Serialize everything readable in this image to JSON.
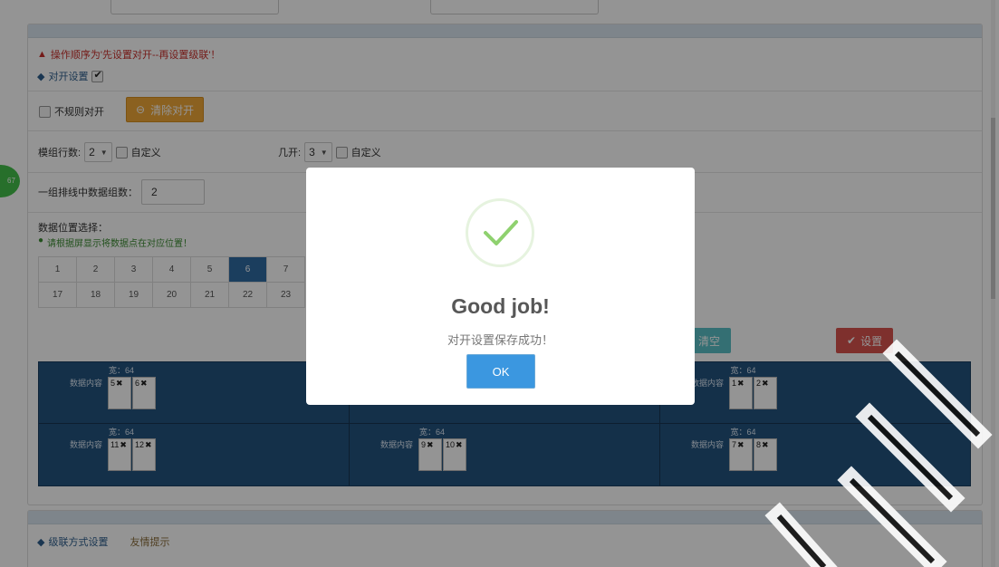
{
  "notices": {
    "warning": "操作顺序为'先设置对开--再设置级联'！",
    "pair_setting_label": "对开设置",
    "data_position_title": "数据位置选择：",
    "data_position_hint": "请根据屏显示将数据点在对应位置！"
  },
  "controls": {
    "irregular_pair_label": "不规则对开",
    "clear_pair_button": "清除对开",
    "module_rows_label": "模组行数:",
    "module_rows_value": "2",
    "custom_label_1": "自定义",
    "split_label": "几开:",
    "split_value": "3",
    "custom_label_2": "自定义",
    "group_count_label": "一组排线中数据组数：",
    "group_count_value": "2",
    "clear_button": "清空",
    "set_button": "设置"
  },
  "position_grid": {
    "row1": [
      "1",
      "2",
      "3",
      "4",
      "5",
      "6",
      "7"
    ],
    "row2": [
      "17",
      "18",
      "19",
      "20",
      "21",
      "22",
      "23"
    ],
    "selected": "6"
  },
  "board": {
    "cells": [
      {
        "width_label": "宽：64",
        "content_label": "数据内容",
        "chips": [
          "5",
          "6"
        ]
      },
      {
        "width_label": "",
        "content_label": "",
        "chips": []
      },
      {
        "width_label": "宽：64",
        "content_label": "数据内容",
        "chips": [
          "1",
          "2"
        ]
      },
      {
        "width_label": "宽：64",
        "content_label": "数据内容",
        "chips": [
          "11",
          "12"
        ]
      },
      {
        "width_label": "宽：64",
        "content_label": "数据内容",
        "chips": [
          "9",
          "10"
        ]
      },
      {
        "width_label": "宽：64",
        "content_label": "数据内容",
        "chips": [
          "7",
          "8"
        ]
      }
    ]
  },
  "footer": {
    "cascade_label": "级联方式设置",
    "tip_link": "友情提示"
  },
  "side_badge": "67",
  "modal": {
    "title": "Good job!",
    "message": "对开设置保存成功！",
    "ok_label": "OK"
  },
  "colors": {
    "accent_blue": "#24537f",
    "success_green": "#8fd16f",
    "ok_button": "#3b97e0",
    "warning_red": "#c9302c",
    "orange_button": "#f0a838"
  }
}
